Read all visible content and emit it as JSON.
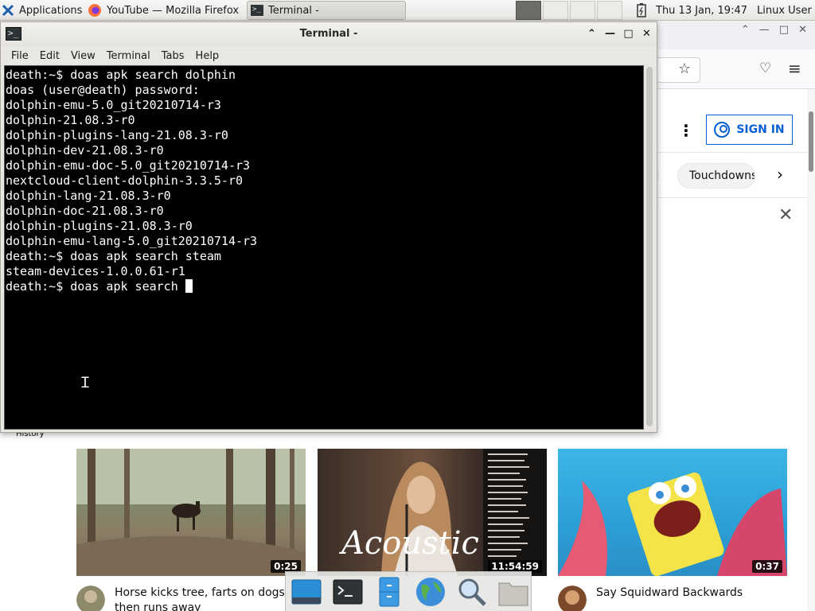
{
  "panel": {
    "applications_label": "Applications",
    "tasks": [
      {
        "label": "YouTube — Mozilla Firefox"
      },
      {
        "label": "Terminal -"
      }
    ],
    "clock": "Thu 13 Jan, 19:47",
    "user": "Linux User"
  },
  "firefox": {
    "signin_label": "SIGN IN",
    "chips": [
      "Touchdowns"
    ],
    "history_label": "History",
    "videos": [
      {
        "title": "Horse kicks tree, farts on dogs then runs away",
        "duration": "0:25"
      },
      {
        "title": "",
        "duration": "11:54:59",
        "thumb_text": "Acoustic"
      },
      {
        "title": "Say Squidward Backwards",
        "duration": "0:37"
      }
    ]
  },
  "terminal": {
    "title": "Terminal -",
    "menu": [
      "File",
      "Edit",
      "View",
      "Terminal",
      "Tabs",
      "Help"
    ],
    "lines": [
      "death:~$ doas apk search dolphin",
      "doas (user@death) password:",
      "dolphin-emu-5.0_git20210714-r3",
      "dolphin-21.08.3-r0",
      "dolphin-plugins-lang-21.08.3-r0",
      "dolphin-dev-21.08.3-r0",
      "dolphin-emu-doc-5.0_git20210714-r3",
      "nextcloud-client-dolphin-3.3.5-r0",
      "dolphin-lang-21.08.3-r0",
      "dolphin-doc-21.08.3-r0",
      "dolphin-plugins-21.08.3-r0",
      "dolphin-emu-lang-5.0_git20210714-r3",
      "death:~$ doas apk search steam",
      "steam-devices-1.0.0.61-r1"
    ],
    "prompt_line": "death:~$ doas apk search "
  },
  "colors": {
    "terminal_bg": "#000000",
    "terminal_fg": "#ffffff",
    "youtube_blue": "#065fd4"
  },
  "icons": {
    "applications": "xfce-mouse-icon",
    "firefox": "firefox-icon",
    "terminal": "terminal-icon",
    "battery": "battery-icon",
    "dock": [
      "desktop-icon",
      "terminal-icon",
      "file-cabinet-icon",
      "globe-icon",
      "magnifier-icon",
      "folder-icon"
    ]
  }
}
